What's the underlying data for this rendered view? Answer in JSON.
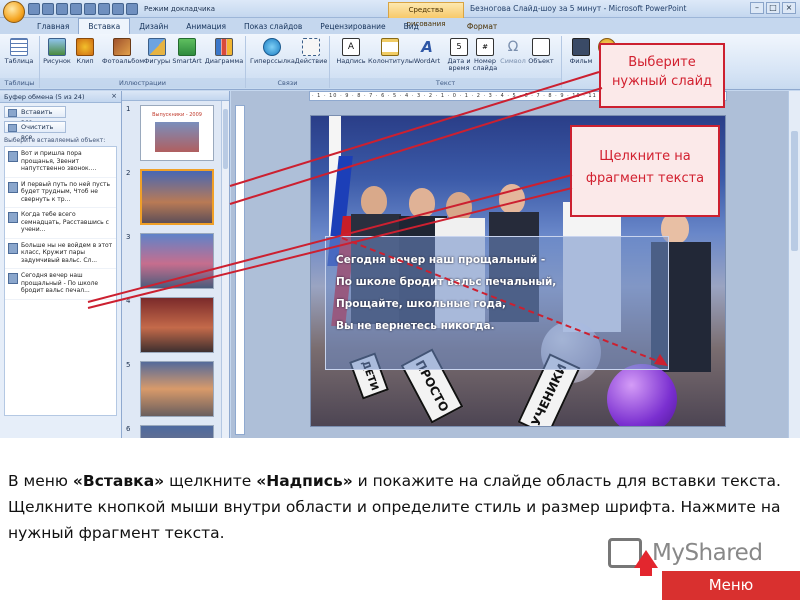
{
  "window": {
    "title": "Безногова Слайд-шоу за 5 минут - Microsoft PowerPoint",
    "context_tab": "Средства рисования",
    "doc_mode": "Режим докладчика"
  },
  "ribbon": {
    "tabs": [
      "Главная",
      "Вставка",
      "Дизайн",
      "Анимация",
      "Показ слайдов",
      "Рецензирование",
      "Вид",
      "Формат"
    ],
    "active_tab": "Вставка",
    "buttons": {
      "table": "Таблица",
      "picture": "Рисунок",
      "clip": "Клип",
      "photoalbum": "Фотоальбом",
      "shapes": "Фигуры",
      "smartart": "SmartArt",
      "chart": "Диаграмма",
      "hyperlink": "Гиперссылка",
      "action": "Действие",
      "textbox": "Надпись",
      "header_footer": "Колонтитулы",
      "wordart": "WordArt",
      "date_time": "Дата и время",
      "slide_number": "Номер слайда",
      "symbol": "Символ",
      "object": "Объект",
      "movie": "Фильм",
      "sound": "Зв"
    },
    "groups": {
      "tables": "Таблицы",
      "illustrations": "Иллюстрации",
      "links": "Связи",
      "text": "Текст"
    }
  },
  "clipboard": {
    "header": "Буфер обмена (5 из 24)",
    "paste_all": "Вставить все",
    "clear_all": "Очистить все",
    "caption": "Выберите вставляемый объект:",
    "items": [
      "Вот и пришла пора прощанья, Звенит напутственно звонок....",
      "И первый путь по ней пусть будет трудным, Чтоб не свернуть к тр...",
      "Когда тебе всего семнадцать, Расставшись с учени...",
      "Больше ны не войдем в этот класс, Кружит пары задумчивый вальс. Сл...",
      "Сегодня вечер наш прощальный - По школе бродит вальс печал..."
    ]
  },
  "slides": {
    "numbers": [
      "1",
      "2",
      "3",
      "4",
      "5",
      "6"
    ],
    "thumb1_title": "Выпускники - 2009",
    "selected": "2"
  },
  "slide": {
    "poem_lines": [
      "Сегодня вечер наш прощальный -",
      "По школе бродит вальс печальный,",
      "Прощайте, школьные года,",
      "Вы не вернетесь никогда."
    ],
    "signs": [
      "ПРОСТО",
      "УЧЕНИКИ",
      "ДЕТИ"
    ]
  },
  "callouts": {
    "select_slide": "Выберите нужный слайд",
    "click_fragment": "Щелкните на фрагмент текста"
  },
  "caption": {
    "p1": "В меню ",
    "menu_insert": "«Вставка»",
    "p2": " щелкните ",
    "cmd_textbox": "«Надпись»",
    "p3": " и покажите на слайде область для вставки текста. Щелкните кнопкой мыши внутри области и определите стиль и размер шрифта. Нажмите на нужный фрагмент текста."
  },
  "logo": "MyShared",
  "menu_button": "Меню",
  "colors": {
    "accent_red": "#d9302f",
    "callout_border": "#cc2030",
    "ribbon_blue": "#c5d7ee"
  }
}
